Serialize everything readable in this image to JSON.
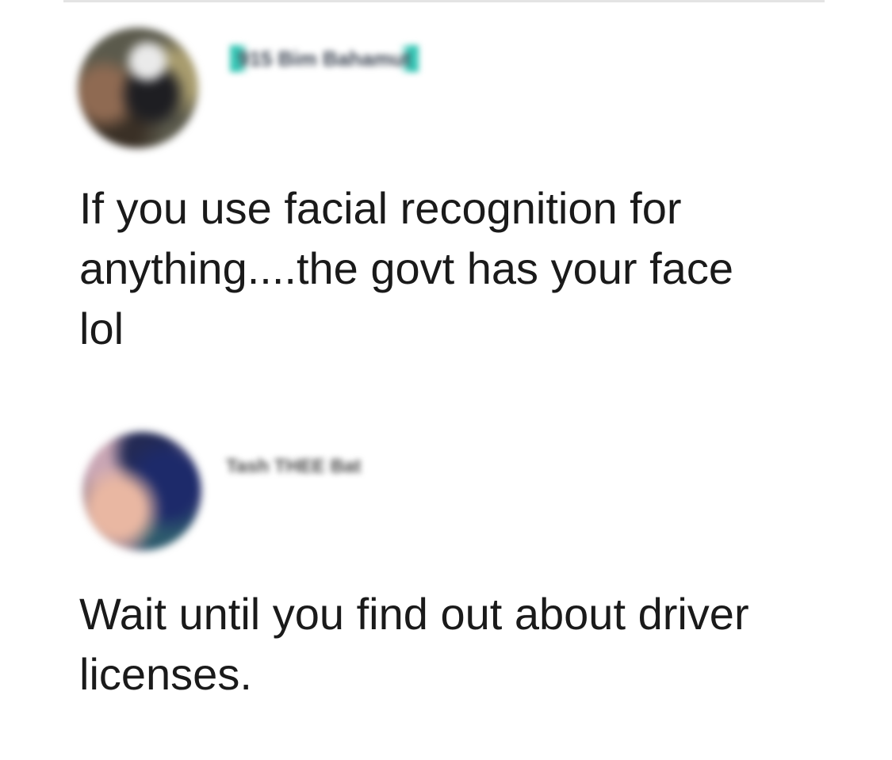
{
  "comments": [
    {
      "author": "915 Bim Bahamut",
      "avatar_icon": "user-avatar",
      "text": "If you use facial recognition for\nanything....the govt has your face\nlol"
    },
    {
      "author": "Tash THEE Bat",
      "avatar_icon": "user-avatar",
      "text": "Wait until you find out about driver\nlicenses."
    }
  ],
  "colors": {
    "background": "#ffffff",
    "text": "#1a1a1a",
    "name_badge_accent": "#37c7b6"
  }
}
